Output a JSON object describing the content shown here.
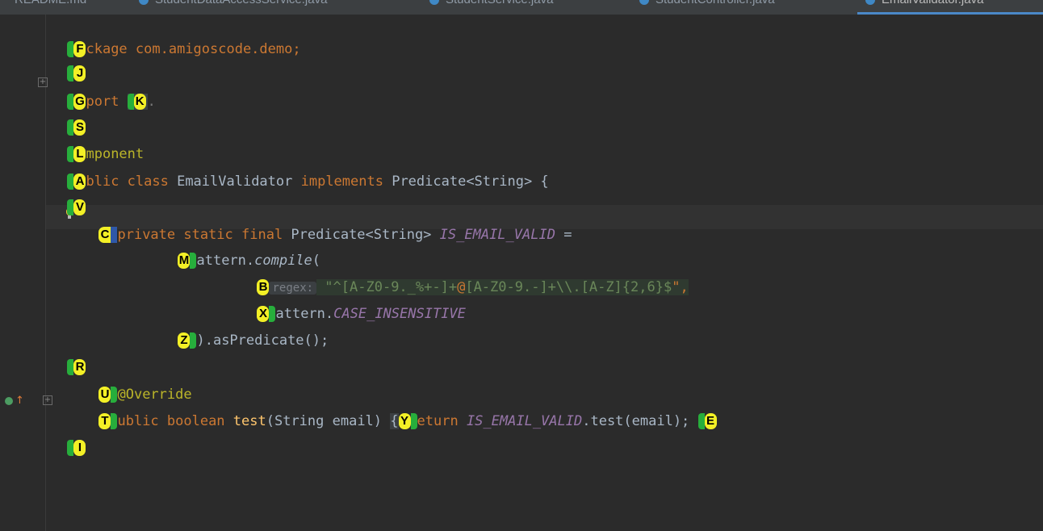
{
  "tabs": [
    {
      "label": "README.md"
    },
    {
      "label": "StudentDataAccessService.java"
    },
    {
      "label": "StudentService.java"
    },
    {
      "label": "StudentController.java"
    },
    {
      "label": "EmailValidator.java",
      "active": true
    }
  ],
  "hints": {
    "F": "F",
    "J": "J",
    "G": "G",
    "K": "K",
    "S": "S",
    "L": "L",
    "A": "A",
    "V": "V",
    "C": "C",
    "M": "M",
    "B": "B",
    "X": "X",
    "Z": "Z",
    "R": "R",
    "U": "U",
    "T": "T",
    "Y": "Y",
    "E": "E",
    "I": "I"
  },
  "code": {
    "l1_rest": "ckage com.amigoscode.demo;",
    "l3_kw": "port ",
    "l3_dots": ".",
    "l5_ann": "mponent",
    "l6_kw": "blic class ",
    "l6_cls": "EmailValidator ",
    "l6_kw2": "implements ",
    "l6_rest": "Predicate<String> {",
    "l8_kw": "private static final ",
    "l8_type": "Predicate<String> ",
    "l8_const": "IS_EMAIL_VALID",
    "l8_eq": " =",
    "l9_a": "attern.",
    "l9_b": "compile",
    "l9_c": "(",
    "l10_inlay": "regex:",
    "l10_q": " \"",
    "l10_re1": "^[A-Z0-9._%+-]+",
    "l10_at": "@",
    "l10_re2": "[A-Z0-9.-]+\\\\.[A-Z]{2,6}$",
    "l10_end": "\",",
    "l11_a": "attern.",
    "l11_const": "CASE_INSENSITIVE",
    "l12_a": ").asPredicate();",
    "l14_ann": "@Override",
    "l15_kw": "ublic boolean ",
    "l15_mth": "test",
    "l15_args": "(String email) ",
    "l15_brace": "{",
    "l15_kw2": "eturn ",
    "l15_const": "IS_EMAIL_VALID",
    "l15_rest": ".test(email); "
  }
}
